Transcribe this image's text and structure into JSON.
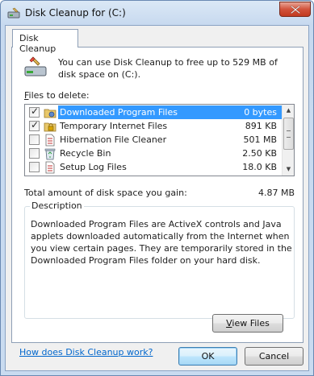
{
  "window": {
    "title": "Disk Cleanup for  (C:)"
  },
  "tab": {
    "label": "Disk Cleanup"
  },
  "intro": {
    "text": "You can use Disk Cleanup to free up to 529 MB of disk space on  (C:)."
  },
  "files": {
    "label_prefix": "F",
    "label_rest": "iles to delete:",
    "items": [
      {
        "name": "Downloaded Program Files",
        "size": "0 bytes",
        "checked": true,
        "selected": true,
        "icon": "folder-gear-icon"
      },
      {
        "name": "Temporary Internet Files",
        "size": "891 KB",
        "checked": true,
        "selected": false,
        "icon": "lock-folder-icon"
      },
      {
        "name": "Hibernation File Cleaner",
        "size": "501 MB",
        "checked": false,
        "selected": false,
        "icon": "document-icon"
      },
      {
        "name": "Recycle Bin",
        "size": "2.50 KB",
        "checked": false,
        "selected": false,
        "icon": "recycle-bin-icon"
      },
      {
        "name": "Setup Log Files",
        "size": "18.0 KB",
        "checked": false,
        "selected": false,
        "icon": "document-icon"
      }
    ]
  },
  "total": {
    "label": "Total amount of disk space you gain:",
    "value": "4.87 MB"
  },
  "description": {
    "title": "Description",
    "text": "Downloaded Program Files are ActiveX controls and Java applets downloaded automatically from the Internet when you view certain pages. They are temporarily stored in the Downloaded Program Files folder on your hard disk."
  },
  "buttons": {
    "view_files_prefix": "V",
    "view_files_rest": "iew Files",
    "ok": "OK",
    "cancel": "Cancel"
  },
  "help_link": "How does Disk Cleanup work?",
  "colors": {
    "selection": "#3399ff",
    "link": "#0066cc"
  }
}
